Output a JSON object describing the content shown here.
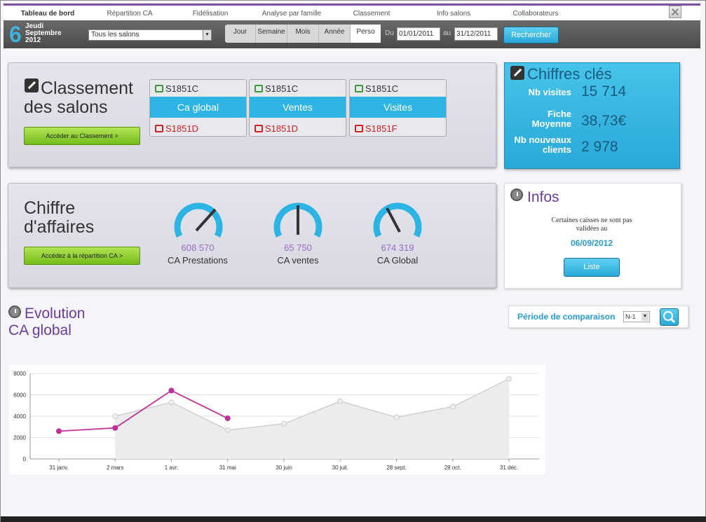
{
  "tabs": [
    {
      "label": "Tableau de bord",
      "active": true
    },
    {
      "label": "Répartition CA",
      "active": false
    },
    {
      "label": "Fidélisation",
      "active": false
    },
    {
      "label": "Analyse par famille",
      "active": false
    },
    {
      "label": "Classement",
      "active": false
    },
    {
      "label": "Info salons",
      "active": false
    },
    {
      "label": "Collaborateurs",
      "active": false
    }
  ],
  "toolbar": {
    "day": "6",
    "weekday": "Jeudi",
    "month": "Septembre",
    "year": "2012",
    "salon_select": "Tous les salons",
    "periods": [
      "Jour",
      "Semaine",
      "Mois",
      "Année",
      "Perso"
    ],
    "active_period": "Perso",
    "from_label": "Du",
    "from_value": "01/01/2011",
    "to_label": "au",
    "to_value": "31/12/2011",
    "search_label": "Rechercher"
  },
  "ranking": {
    "title_line1": "Classement",
    "title_line2": "des salons",
    "button_label": "Accéder au Classement >",
    "cards": [
      {
        "top": "S1851C",
        "category": "Ca global",
        "bottom": "S1851D"
      },
      {
        "top": "S1851C",
        "category": "Ventes",
        "bottom": "S1851D"
      },
      {
        "top": "S1851C",
        "category": "Visites",
        "bottom": "S1851F"
      }
    ]
  },
  "revenue": {
    "title_line1": "Chiffre",
    "title_line2": "d'affaires",
    "button_label": "Accédez à la répartition CA >",
    "gauges": [
      {
        "value": "608 570",
        "label": "CA Prestations"
      },
      {
        "value": "65 750",
        "label": "CA ventes"
      },
      {
        "value": "674 319",
        "label": "CA Global"
      }
    ]
  },
  "key_figures": {
    "title": "Chiffres clés",
    "items": [
      {
        "label1": "Nb visites",
        "label2": "",
        "value": "15 714"
      },
      {
        "label1": "Fiche",
        "label2": "Moyenne",
        "value": "38,73€"
      },
      {
        "label1": "Nb nouveaux",
        "label2": "clients",
        "value": "2 978"
      }
    ]
  },
  "infos": {
    "title": "Infos",
    "message_line1": "Certaines caisses ne sont pas",
    "message_line2": "validées au",
    "date": "06/09/2012",
    "button_label": "Liste"
  },
  "evolution": {
    "title_line1": "Evolution",
    "title_line2": "CA global",
    "comparison_label": "Période de comparaison",
    "comparison_value": "N-1"
  },
  "colors": {
    "accent_blue": "#2eb4e4",
    "purple": "#6a3c9a",
    "series_current": "#c0309a",
    "series_previous": "#c8c8c8"
  },
  "chart_data": {
    "type": "line",
    "x": [
      "31 janv.",
      "2 mars",
      "1 avr.",
      "31 mai",
      "30 juin",
      "30 juil.",
      "28 sept.",
      "28 oct.",
      "31 déc."
    ],
    "y_ticks": [
      0,
      2000,
      4000,
      6000,
      8000
    ],
    "ylim": [
      0,
      8000
    ],
    "grid": true,
    "series": [
      {
        "points": [
          [
            "2 mars",
            4000
          ],
          [
            "1 avr.",
            5300
          ],
          [
            "31 mai",
            2700
          ],
          [
            "30 juin",
            3300
          ],
          [
            "30 juil.",
            5400
          ],
          [
            "28 sept.",
            3900
          ],
          [
            "28 oct.",
            4900
          ],
          [
            "31 déc.",
            7500
          ]
        ]
      },
      {
        "points": [
          [
            "31 janv.",
            2600
          ],
          [
            "2 mars",
            2900
          ],
          [
            "1 avr.",
            6400
          ],
          [
            "31 mai",
            3800
          ]
        ]
      }
    ]
  }
}
